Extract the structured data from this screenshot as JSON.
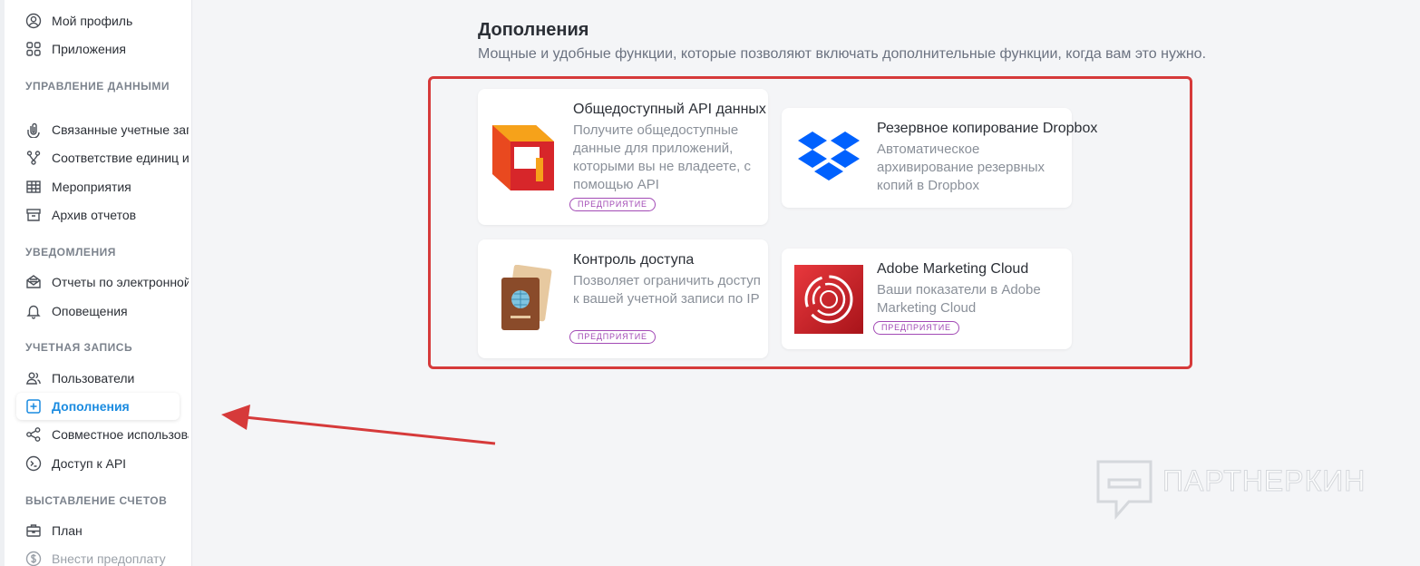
{
  "sidebar": {
    "items_top": [
      {
        "label": "Мой профиль",
        "icon": "user-circle-icon"
      },
      {
        "label": "Приложения",
        "icon": "apps-grid-icon"
      }
    ],
    "sections": [
      {
        "heading": "УПРАВЛЕНИЕ ДАННЫМИ",
        "items": [
          {
            "label": "Связанные учетные записи",
            "icon": "link-icon"
          },
          {
            "label": "Соответствие единиц измерения",
            "icon": "branch-icon"
          },
          {
            "label": "Мероприятия",
            "icon": "table-icon"
          },
          {
            "label": "Архив отчетов",
            "icon": "archive-icon"
          }
        ]
      },
      {
        "heading": "УВЕДОМЛЕНИЯ",
        "items": [
          {
            "label": "Отчеты по электронной почте",
            "icon": "mail-report-icon"
          },
          {
            "label": "Оповещения",
            "icon": "bell-icon"
          }
        ]
      },
      {
        "heading": "УЧЕТНАЯ ЗАПИСЬ",
        "items": [
          {
            "label": "Пользователи",
            "icon": "users-icon"
          },
          {
            "label": "Дополнения",
            "icon": "plus-square-icon",
            "active": true
          },
          {
            "label": "Совместное использование",
            "icon": "share-icon"
          },
          {
            "label": "Доступ к API",
            "icon": "terminal-icon"
          }
        ]
      },
      {
        "heading": "ВЫСТАВЛЕНИЕ СЧЕТОВ",
        "items": [
          {
            "label": "План",
            "icon": "briefcase-icon"
          },
          {
            "label": "Внести предоплату",
            "icon": "dollar-icon",
            "disabled": true
          }
        ]
      }
    ]
  },
  "main": {
    "title": "Дополнения",
    "subtitle": "Мощные и удобные функции, которые позволяют включать дополнительные функции, когда вам это нужно."
  },
  "cards": [
    {
      "title": "Общедоступный API данных",
      "description": "Получите общедоступные данные для приложений, которыми вы не владеете, с помощью API",
      "badge": "ПРЕДПРИЯТИЕ",
      "icon": "public-api-logo"
    },
    {
      "title": "Резервное копирование Dropbox",
      "description": "Автоматическое архивирование резервных копий в Dropbox",
      "icon": "dropbox-logo"
    },
    {
      "title": "Контроль доступа",
      "description": "Позволяет ограничить доступ к вашей учетной записи по IP",
      "badge": "ПРЕДПРИЯТИЕ",
      "icon": "passport-logo"
    },
    {
      "title": "Adobe Marketing Cloud",
      "description": "Ваши показатели в Adobe Marketing Cloud",
      "badge": "ПРЕДПРИЯТИЕ",
      "icon": "adobe-marketing-cloud-logo"
    }
  ],
  "watermark": {
    "text": "ПАРТНЕРКИН"
  },
  "colors": {
    "accent": "#1a8be0",
    "highlight": "#d63a3a",
    "badge": "#a24ab5"
  }
}
